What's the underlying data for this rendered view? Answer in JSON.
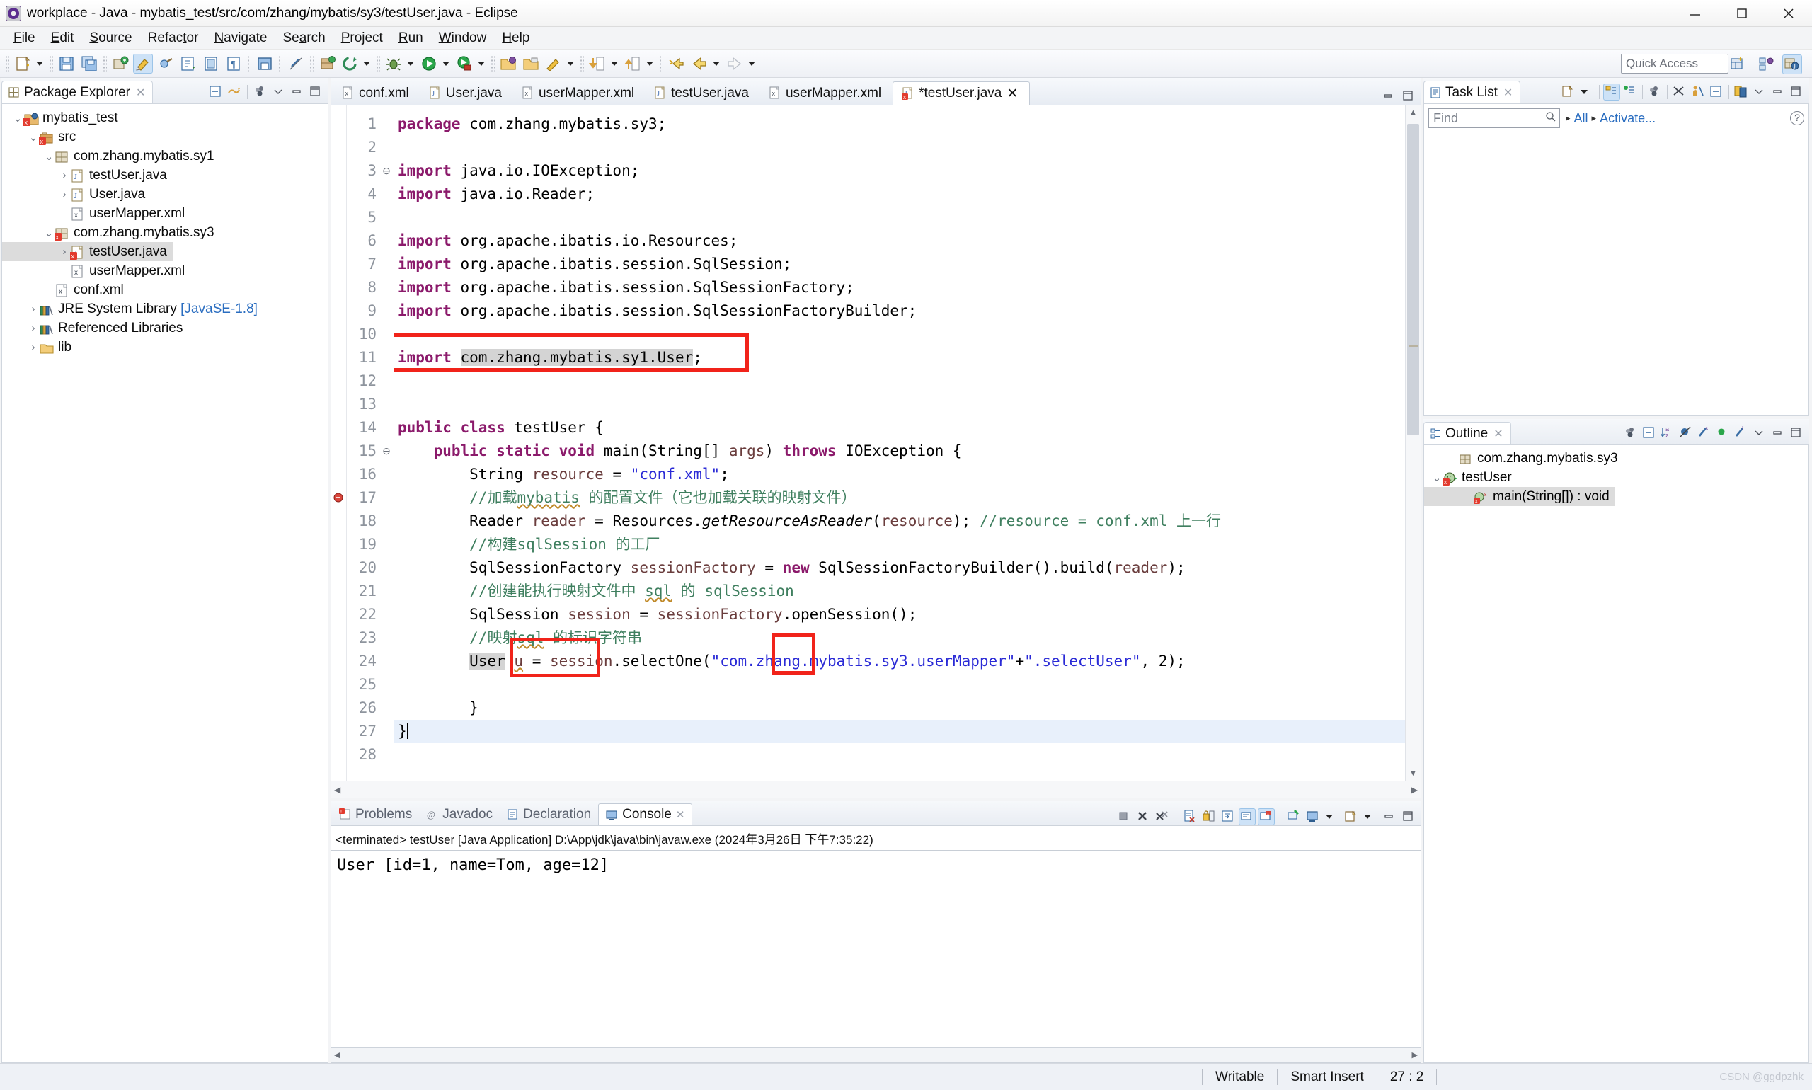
{
  "window": {
    "title": "workplace - Java - mybatis_test/src/com/zhang/mybatis/sy3/testUser.java - Eclipse",
    "app_icon": "eclipse-icon",
    "minimize": "minimize-button",
    "maximize": "maximize-button",
    "close": "close-button"
  },
  "menu": {
    "items": [
      {
        "label": "File",
        "mnemonic": "F"
      },
      {
        "label": "Edit",
        "mnemonic": "E"
      },
      {
        "label": "Source",
        "mnemonic": "S"
      },
      {
        "label": "Refactor",
        "mnemonic": "t"
      },
      {
        "label": "Navigate",
        "mnemonic": "N"
      },
      {
        "label": "Search",
        "mnemonic": "a"
      },
      {
        "label": "Project",
        "mnemonic": "P"
      },
      {
        "label": "Run",
        "mnemonic": "R"
      },
      {
        "label": "Window",
        "mnemonic": "W"
      },
      {
        "label": "Help",
        "mnemonic": "H"
      }
    ]
  },
  "toolbar": {
    "quick_access_placeholder": "Quick Access",
    "icons": [
      "new-wizard-icon",
      "new-dropdown-arrow",
      "save-icon",
      "save-all-icon",
      "new-java-package-icon",
      "java-perspective-icon",
      "external-tools-icon",
      "open-type-icon",
      "open-task-icon",
      "pilcrow-icon",
      "print-icon",
      "link-icon",
      "build-icon",
      "refresh-icon",
      "debug-icon",
      "run-icon",
      "run-coverage-icon",
      "open-folder-icon",
      "open-resource-icon",
      "annotation-icon",
      "next-annotation-icon",
      "previous-annotation-icon",
      "back-icon",
      "forward-icon"
    ],
    "perspective_icons": [
      "new-perspective-icon",
      "java-ee-perspective-icon",
      "java-perspective-icon"
    ]
  },
  "package_explorer": {
    "tab_label": "Package Explorer",
    "tab_close": "close-icon",
    "tools": [
      "collapse-all-icon",
      "link-with-editor-icon",
      "view-menu-icon",
      "minimize-icon",
      "maximize-icon"
    ],
    "tree": [
      {
        "label": "mybatis_test",
        "icon": "java-project-icon",
        "indent": 0,
        "twisty": "v",
        "error": true,
        "selected": false
      },
      {
        "label": "src",
        "icon": "source-folder-icon",
        "indent": 1,
        "twisty": "v",
        "error": true,
        "selected": false
      },
      {
        "label": "com.zhang.mybatis.sy1",
        "icon": "package-icon",
        "indent": 2,
        "twisty": "v",
        "error": false,
        "selected": false
      },
      {
        "label": "testUser.java",
        "icon": "java-file-icon",
        "indent": 3,
        "twisty": ">",
        "error": false,
        "selected": false
      },
      {
        "label": "User.java",
        "icon": "java-file-icon",
        "indent": 3,
        "twisty": ">",
        "error": false,
        "selected": false
      },
      {
        "label": "userMapper.xml",
        "icon": "xml-file-icon",
        "indent": 3,
        "twisty": "",
        "error": false,
        "selected": false
      },
      {
        "label": "com.zhang.mybatis.sy3",
        "icon": "package-icon",
        "indent": 2,
        "twisty": "v",
        "error": true,
        "selected": false
      },
      {
        "label": "testUser.java",
        "icon": "java-file-icon",
        "indent": 3,
        "twisty": ">",
        "error": true,
        "selected": true
      },
      {
        "label": "userMapper.xml",
        "icon": "xml-file-icon",
        "indent": 3,
        "twisty": "",
        "error": false,
        "selected": false
      },
      {
        "label": "conf.xml",
        "icon": "xml-file-icon",
        "indent": 2,
        "twisty": "",
        "error": false,
        "selected": false
      },
      {
        "label": "JRE System Library",
        "suffix": "[JavaSE-1.8]",
        "icon": "library-icon",
        "indent": 1,
        "twisty": ">",
        "error": false,
        "selected": false
      },
      {
        "label": "Referenced Libraries",
        "icon": "library-icon",
        "indent": 1,
        "twisty": ">",
        "error": false,
        "selected": false
      },
      {
        "label": "lib",
        "icon": "folder-icon",
        "indent": 1,
        "twisty": ">",
        "error": false,
        "selected": false
      }
    ]
  },
  "editor": {
    "tabs": [
      {
        "label": "conf.xml",
        "icon": "xml-file-icon",
        "active": false,
        "dirty": false
      },
      {
        "label": "User.java",
        "icon": "java-file-icon",
        "active": false,
        "dirty": false
      },
      {
        "label": "userMapper.xml",
        "icon": "xml-file-icon",
        "active": false,
        "dirty": false
      },
      {
        "label": "testUser.java",
        "icon": "java-file-icon",
        "active": false,
        "dirty": false
      },
      {
        "label": "userMapper.xml",
        "icon": "xml-file-icon",
        "active": false,
        "dirty": false
      },
      {
        "label": "*testUser.java",
        "icon": "java-file-error-icon",
        "active": true,
        "dirty": true
      }
    ],
    "tab_close": "close-icon",
    "line_numbers": [
      1,
      2,
      3,
      4,
      5,
      6,
      7,
      8,
      9,
      10,
      11,
      12,
      13,
      14,
      15,
      16,
      17,
      18,
      19,
      20,
      21,
      22,
      23,
      24,
      25,
      26,
      27,
      28
    ],
    "code_lines": [
      "package com.zhang.mybatis.sy3;",
      "",
      "import java.io.IOException;",
      "import java.io.Reader;",
      "",
      "import org.apache.ibatis.io.Resources;",
      "import org.apache.ibatis.session.SqlSession;",
      "import org.apache.ibatis.session.SqlSessionFactory;",
      "import org.apache.ibatis.session.SqlSessionFactoryBuilder;",
      "",
      "import com.zhang.mybatis.sy1.User;",
      "",
      "",
      "public class testUser {",
      "    public static void main(String[] args) throws IOException {",
      "        String resource = \"conf.xml\";",
      "        //加载mybatis 的配置文件（它也加载关联的映射文件）",
      "        Reader reader = Resources.getResourceAsReader(resource); //resource = conf.xml 上一行",
      "        //构建sqlSession 的工厂",
      "        SqlSessionFactory sessionFactory = new SqlSessionFactoryBuilder().build(reader);",
      "        //创建能执行映射文件中 sql 的 sqlSession",
      "        SqlSession session = sessionFactory.openSession();",
      "        //映射sql 的标识字符串",
      "        User u = session.selectOne(\"com.zhang.mybatis.sy3.userMapper\"+\".selectUser\", 2);",
      "",
      "        }",
      "}",
      ""
    ],
    "annotations": [
      {
        "name": "import-statement-highlight-box",
        "target_line": 11
      },
      {
        "name": "user-type-highlight-box",
        "target_line": 24
      },
      {
        "name": "selectone-call-highlight-box",
        "target_line": 24
      }
    ]
  },
  "console": {
    "tabs": [
      {
        "label": "Problems",
        "icon": "problems-icon",
        "active": false
      },
      {
        "label": "Javadoc",
        "icon": "javadoc-icon",
        "active": false
      },
      {
        "label": "Declaration",
        "icon": "declaration-icon",
        "active": false
      },
      {
        "label": "Console",
        "icon": "console-icon",
        "active": true
      }
    ],
    "tab_close": "close-icon",
    "launch_header": "<terminated> testUser [Java Application] D:\\App\\jdk\\java\\bin\\javaw.exe (2024年3月26日 下午7:35:22)",
    "output": "User [id=1, name=Tom, age=12]",
    "tools": [
      "terminate-icon",
      "remove-launch-icon",
      "remove-all-terminated-icon",
      "clear-console-icon",
      "scroll-lock-icon",
      "word-wrap-icon",
      "show-console-on-output-icon",
      "pin-console-icon",
      "new-console-view-icon",
      "display-selected-console-icon",
      "open-console-dropdown-icon",
      "minimize-icon",
      "maximize-icon"
    ]
  },
  "task_list": {
    "tab_label": "Task List",
    "tab_close": "close-icon",
    "find_placeholder": "Find",
    "find_value": "",
    "search_icon": "search-icon",
    "filter_all": "All",
    "filter_activate": "Activate...",
    "help_icon": "help-icon",
    "tools": [
      "new-task-icon",
      "new-task-dropdown",
      "categorized-presentation-icon",
      "scheduled-presentation-icon",
      "focus-on-workweek-icon",
      "filter-complete-icon",
      "collapse-all-icon",
      "restore-tasks-icon",
      "view-menu-icon",
      "minimize-icon",
      "maximize-icon"
    ]
  },
  "outline": {
    "tab_label": "Outline",
    "tab_close": "close-icon",
    "tools": [
      "focus-on-active-task-icon",
      "collapse-all-icon",
      "sort-icon",
      "hide-fields-icon",
      "hide-static-icon",
      "hide-non-public-icon",
      "hide-local-types-icon",
      "view-menu-icon",
      "minimize-icon",
      "maximize-icon"
    ],
    "tree": [
      {
        "label": "com.zhang.mybatis.sy3",
        "icon": "package-declaration-icon",
        "indent": 1,
        "twisty": "",
        "selected": false
      },
      {
        "label": "testUser",
        "icon": "class-error-icon",
        "indent": 0,
        "twisty": "v",
        "selected": false
      },
      {
        "label": "main(String[]) : void",
        "icon": "public-static-method-error-icon",
        "indent": 2,
        "twisty": "",
        "selected": true
      }
    ]
  },
  "status_bar": {
    "writable": "Writable",
    "insert_mode": "Smart Insert",
    "cursor_position": "27 : 2",
    "watermark": "CSDN @ggdpzhk"
  },
  "colors": {
    "accent": "#2a6dc0",
    "highlight_box": "#f1231a",
    "keyword": "#8b1a6b",
    "string": "#2a2ad6",
    "comment": "#3f7f5f",
    "field": "#6a3d3d",
    "selection": "#d4d4d4",
    "current_line": "#e8f0fb"
  }
}
